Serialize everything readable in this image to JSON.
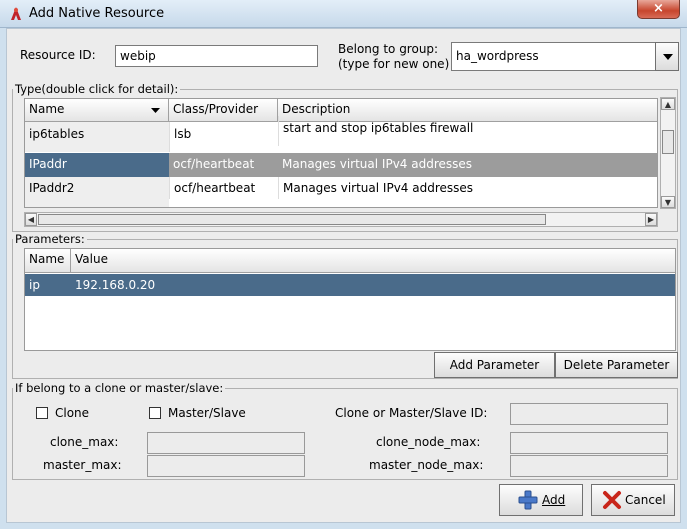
{
  "window": {
    "title": "Add Native Resource",
    "close_glyph": "×"
  },
  "form": {
    "resource_id_label": "Resource ID:",
    "resource_id_value": "webip",
    "group_label_line1": "Belong to group:",
    "group_label_line2": "(type for new one)",
    "group_value": "ha_wordpress"
  },
  "type_table": {
    "section_label": "Type(double click for detail):",
    "headers": [
      "Name",
      "Class/Provider",
      "Description"
    ],
    "rows": [
      {
        "name": "ip6tables",
        "provider": "lsb",
        "description": "start and stop ip6tables firewall"
      },
      {
        "name": "IPaddr",
        "provider": "ocf/heartbeat",
        "description": "Manages virtual IPv4 addresses"
      },
      {
        "name": "IPaddr2",
        "provider": "ocf/heartbeat",
        "description": "Manages virtual IPv4 addresses"
      }
    ]
  },
  "parameters": {
    "section_label": "Parameters:",
    "headers": [
      "Name",
      "Value"
    ],
    "rows": [
      {
        "name": "ip",
        "value": "192.168.0.20"
      }
    ],
    "add_button": "Add Parameter",
    "delete_button": "Delete Parameter"
  },
  "clone": {
    "section_label": "If belong to a clone or master/slave:",
    "clone_checkbox": "Clone",
    "master_slave_checkbox": "Master/Slave",
    "clone_or_ms_id_label": "Clone or Master/Slave ID:",
    "clone_max_label": "clone_max:",
    "clone_node_max_label": "clone_node_max:",
    "master_max_label": "master_max:",
    "master_node_max_label": "master_node_max:"
  },
  "footer": {
    "add_label": "Add",
    "cancel_label": "Cancel"
  },
  "colors": {
    "selected_row_left": "#4a6b8a",
    "selected_row_right": "#9c9c9c",
    "param_selected": "#4a6b8a"
  }
}
